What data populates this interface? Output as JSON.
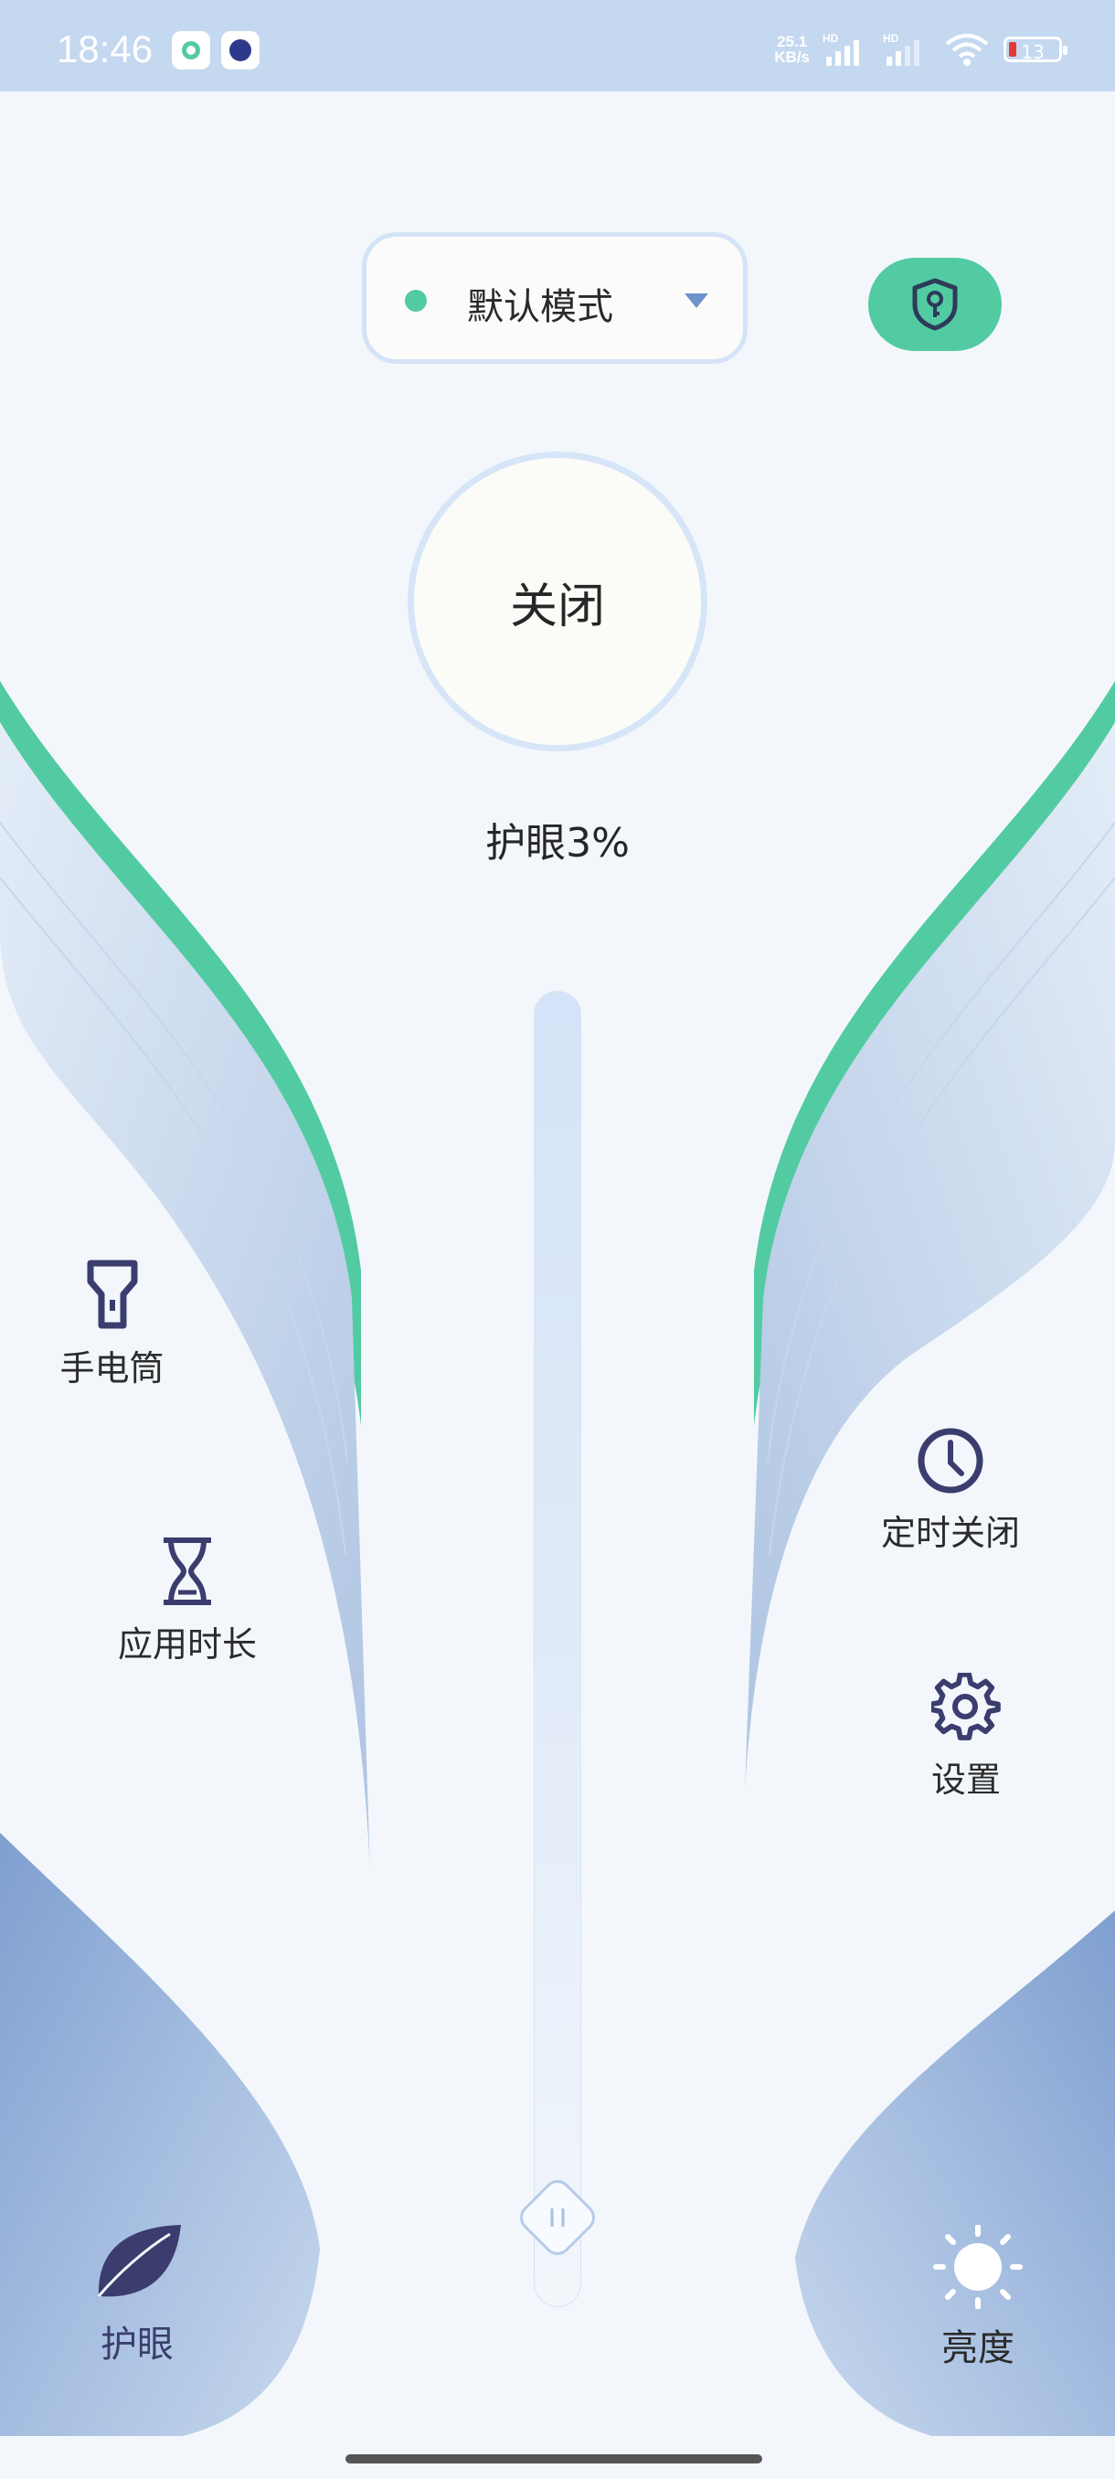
{
  "status_bar": {
    "time": "18:46",
    "network_speed": "25.1",
    "network_speed_unit": "KB/s",
    "hd1": "HD",
    "hd2": "HD",
    "battery": "13"
  },
  "mode_selector": {
    "label": "默认模式"
  },
  "power": {
    "label": "关闭"
  },
  "eye_level": {
    "text": "护眼3%",
    "value_percent": 3
  },
  "tools": {
    "flashlight": "手电筒",
    "app_duration": "应用时长",
    "timer_off": "定时关闭",
    "settings": "设置"
  },
  "bottom_nav": {
    "eye": "护眼",
    "brightness": "亮度"
  },
  "colors": {
    "accent_green": "#52cba2",
    "icon_navy": "#3a3d6e",
    "status_bar": "#c4d8f0"
  },
  "icons": [
    "shield-key-icon",
    "flashlight-icon",
    "hourglass-icon",
    "clock-icon",
    "gear-icon",
    "leaf-icon",
    "sun-icon"
  ]
}
